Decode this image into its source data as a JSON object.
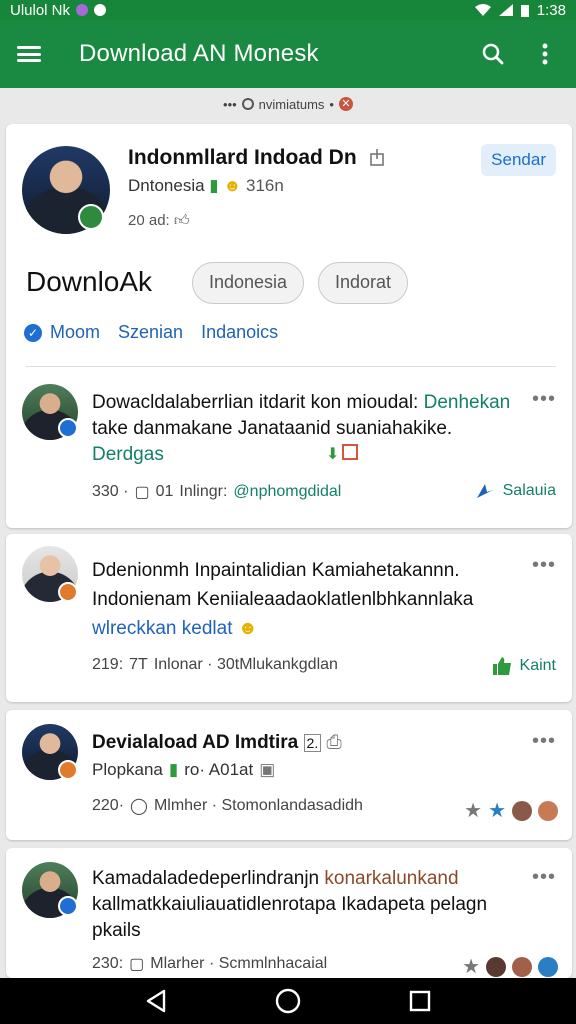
{
  "status": {
    "left_text": "Ululol Nk",
    "time": "1:38"
  },
  "appbar": {
    "title": "Download AN Monesk"
  },
  "chip": {
    "label": "nvimiatums"
  },
  "profile": {
    "name": "Indonmllard Indoad Dn",
    "subtitle": "Dntonesia",
    "subtitle_count": "316n",
    "meta": "20 ad:",
    "send_label": "Sendar",
    "big_title": "DownloAk",
    "pills": [
      "Indonesia",
      "Indorat"
    ],
    "tabs": [
      "Moom",
      "Szenian",
      "Indanoics"
    ]
  },
  "posts": [
    {
      "text_main": "Dowacldalaberrlian itdarit kon mioudal:",
      "text_accent": "Denhekan",
      "text_line2": "take danmakane Janataanid suaniahakike.",
      "text_line3": "Derdgas",
      "meta_count": "330 ·",
      "meta_num": "01",
      "meta_label": "Inlingr:",
      "meta_tag": "@nphomgdidal",
      "action_label": "Salauia",
      "more": "•••"
    },
    {
      "text_main": "Ddenionmh Inpaintalidian Kamiahetakannn. Indonienam Keniialeaadaoklatlenlbhkannlaka",
      "text_blue": "wlreckkan",
      "text_blue2": "kedlat",
      "meta_count": "219:",
      "meta_num": "7T",
      "meta_label": "Inlonar · 30tMlukankgdlan",
      "action_label": "Kaint",
      "more": "•••"
    },
    {
      "title": "Devialaload AD Imdtira",
      "title_suffix": "2.",
      "sub": "Plopkana",
      "sub2": "ro· A01at",
      "meta_count": "220·",
      "meta_label": "Mlmher · Stomonlandasadidh",
      "more": "•••"
    },
    {
      "text_main": "Kamadaladedeperlindranjn",
      "text_accent": "konarkalunkand",
      "text_line2": "kallmatkkaiuliauatidlenrotapa Ikadapeta pelagn",
      "text_line3": "pkails",
      "meta_count": "230:",
      "meta_label": "Mlarher · Scmmlnhacaial",
      "more": "•••"
    }
  ],
  "colors": {
    "appbar": "#1a8a43",
    "accent": "#137f68",
    "link": "#1f63b8"
  }
}
